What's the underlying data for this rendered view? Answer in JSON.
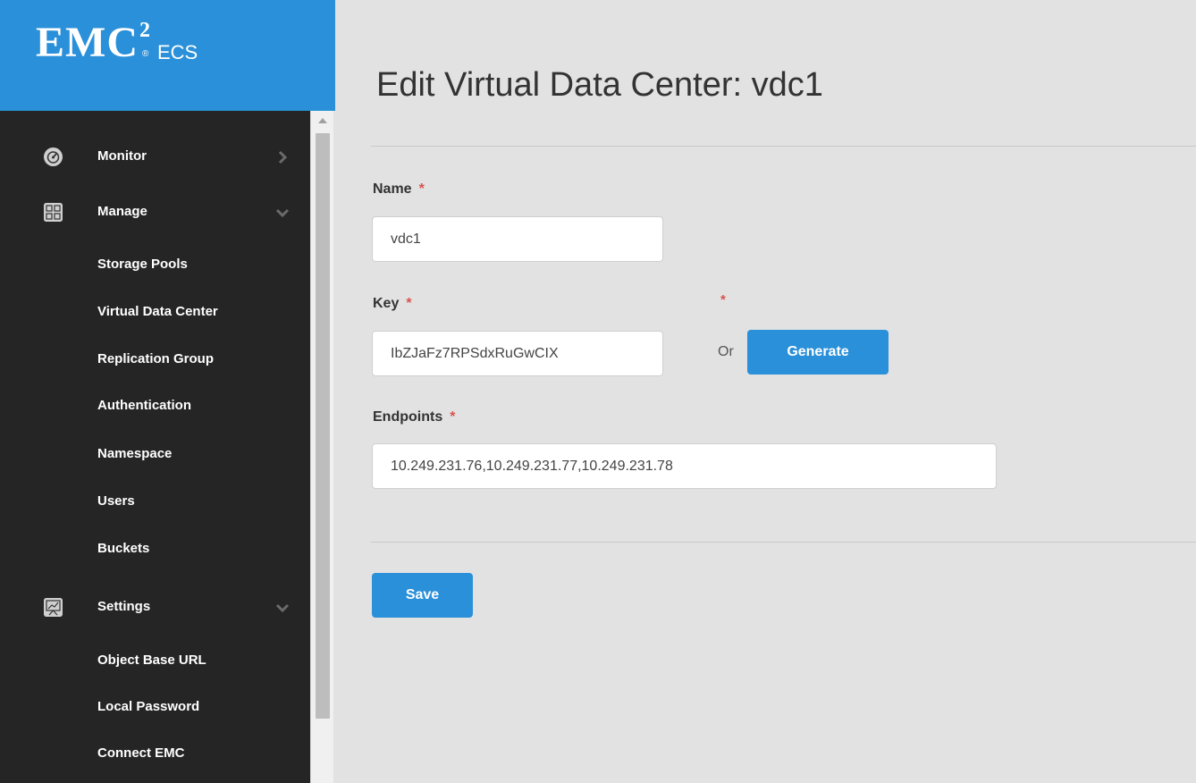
{
  "brand": {
    "logo_text": "EMC",
    "logo_superscript": "2",
    "logo_reg": "®",
    "product": "ECS"
  },
  "sidebar": {
    "groups": [
      {
        "label": "Monitor",
        "icon": "dashboard-icon",
        "chevron": "chevron-right-icon"
      },
      {
        "label": "Manage",
        "icon": "manage-grid-icon",
        "chevron": "chevron-down-icon"
      },
      {
        "label": "Settings",
        "icon": "settings-chart-icon",
        "chevron": "chevron-down-icon"
      }
    ],
    "manage_items": [
      "Storage Pools",
      "Virtual Data Center",
      "Replication Group",
      "Authentication",
      "Namespace",
      "Users",
      "Buckets"
    ],
    "settings_items": [
      "Object Base URL",
      "Local Password",
      "Connect EMC"
    ]
  },
  "main": {
    "title": "Edit Virtual Data Center: vdc1",
    "form": {
      "required_marker": "*",
      "name": {
        "label": "Name",
        "value": "vdc1"
      },
      "key": {
        "label": "Key",
        "value": "IbZJaFz7RPSdxRuGwCIX",
        "or": "Or",
        "generate_label": "Generate"
      },
      "endpoints": {
        "label": "Endpoints",
        "value": "10.249.231.76,10.249.231.77,10.249.231.78"
      },
      "save_label": "Save"
    }
  },
  "colors": {
    "brand_blue": "#2a90d9",
    "sidebar_bg": "#252525",
    "main_bg": "#e2e2e2",
    "required_red": "#d9534f"
  }
}
